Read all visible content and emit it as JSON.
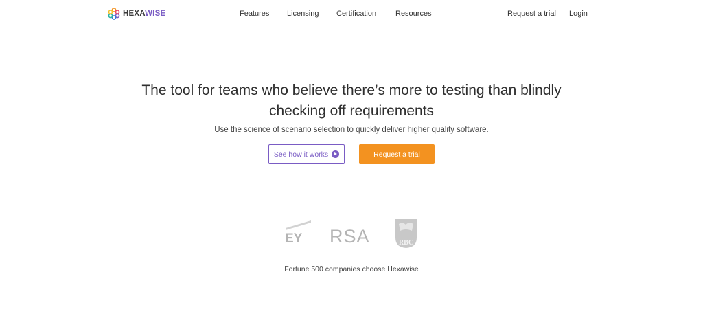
{
  "header": {
    "logo": {
      "prefix": "HEXA",
      "suffix": "WISE",
      "icon": "hexawise-logo-icon"
    },
    "nav": {
      "features": "Features",
      "licensing": "Licensing",
      "certification": "Certification",
      "resources": "Resources"
    },
    "actions": {
      "request_trial": "Request a trial",
      "login": "Login"
    }
  },
  "hero": {
    "title": "The tool for teams who believe there’s more to testing than blindly checking off requirements",
    "subtitle": "Use the science of scenario selection to quickly deliver higher quality software.",
    "secondary_button": "See how it works",
    "secondary_button_icon": "play-circle-icon",
    "primary_button": "Request a trial"
  },
  "clients": {
    "logos": [
      "EY",
      "RSA",
      "RBC"
    ],
    "caption": "Fortune 500 companies choose Hexawise"
  },
  "colors": {
    "accent_purple": "#7a5cc4",
    "accent_orange": "#f39220",
    "logo_gray": "#b8b8b8"
  }
}
